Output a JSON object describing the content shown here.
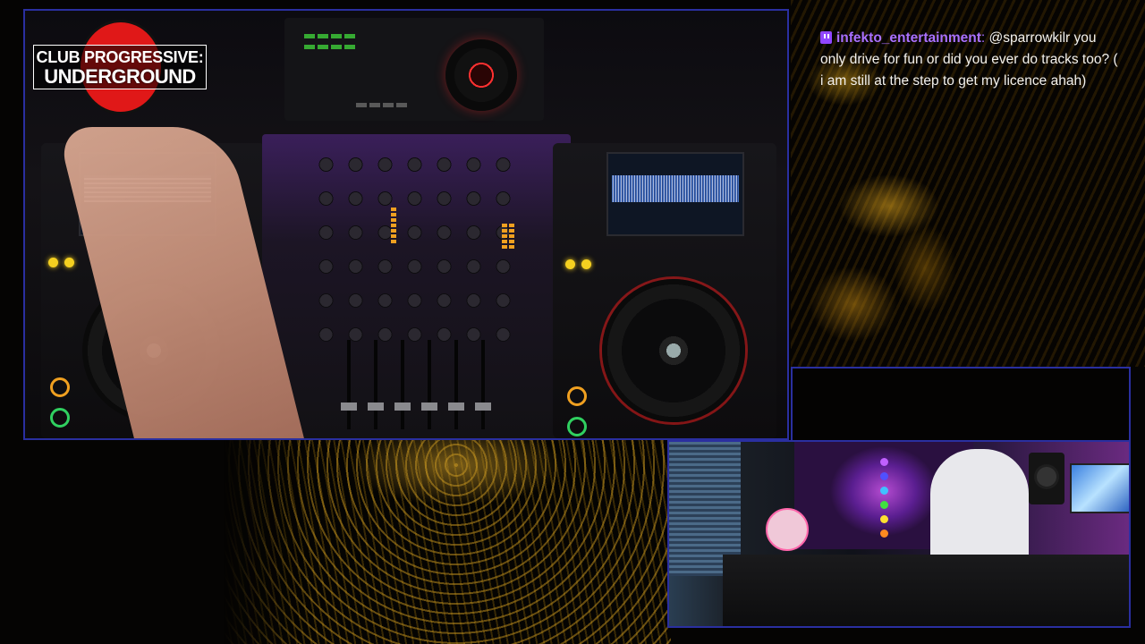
{
  "logo": {
    "line1": "CLUB PROGRESSIVE:",
    "line2": "UNDERGROUND"
  },
  "chat": {
    "icon": "twitch-badge-icon",
    "username": "infekto_entertainment",
    "separator": ":",
    "message": "@sparrowkilr you only drive for fun or did you ever do tracks too? ( i am still at the step to get my licence ahah)"
  },
  "colors": {
    "frame_border": "#2a2fa0",
    "username": "#a970ff",
    "logo_red": "#e01818",
    "chat_text": "#f4f2ee"
  }
}
